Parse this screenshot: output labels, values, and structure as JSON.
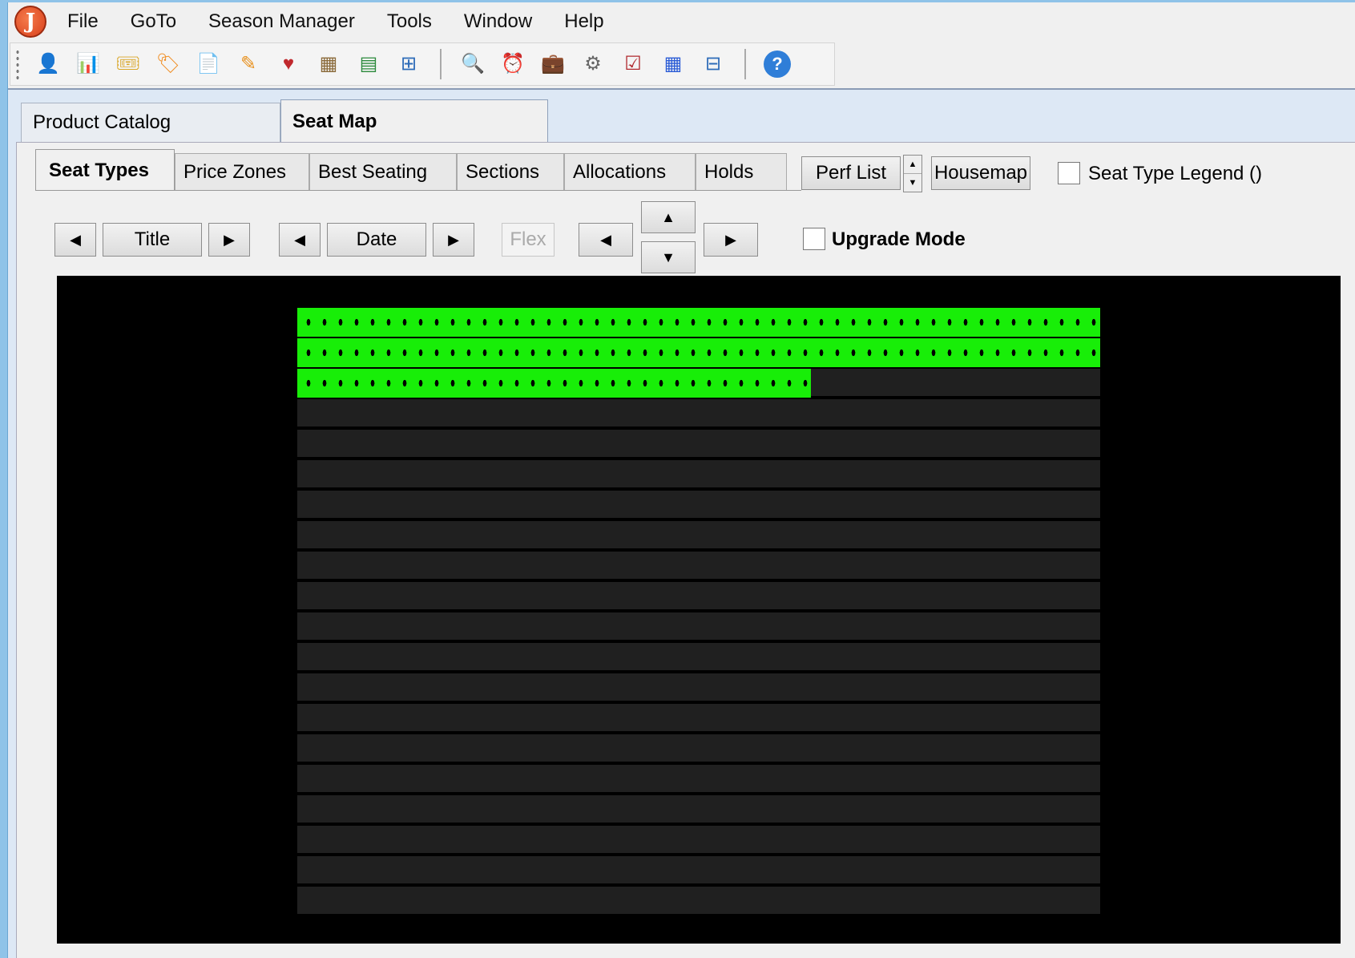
{
  "menu": [
    "File",
    "GoTo",
    "Season Manager",
    "Tools",
    "Window",
    "Help"
  ],
  "toolbar": {
    "icons_group1": [
      "patron-icon",
      "report-icon",
      "ticket-icon",
      "pricing-icon",
      "document-icon",
      "edit-ticket-icon",
      "donation-icon",
      "grid-edit-icon",
      "excel-icon",
      "network-icon"
    ],
    "icons_group2": [
      "search-user-icon",
      "alarm-clock-icon",
      "briefcase-icon",
      "settings-gear-icon",
      "checklist-icon",
      "calendar-grid-icon",
      "network-search-icon"
    ],
    "icons_group3": [
      "help-icon"
    ]
  },
  "outer_tabs": {
    "product_catalog": "Product Catalog",
    "seat_map": "Seat Map"
  },
  "inner_tabs": {
    "seat_types": "Seat Types",
    "price_zones": "Price Zones",
    "best_seating": "Best Seating",
    "sections": "Sections",
    "allocations": "Allocations",
    "holds": "Holds"
  },
  "controls": {
    "perf_list": "Perf List",
    "housemap": "Housemap",
    "seat_type_legend": "Seat Type Legend  ()",
    "title": "Title",
    "date": "Date",
    "flex": "Flex",
    "upgrade_mode": "Upgrade Mode"
  },
  "seat_map": {
    "total_rows": 20,
    "row_fill_fractions": [
      1,
      1,
      0.64,
      0,
      0,
      0,
      0,
      0,
      0,
      0,
      0,
      0,
      0,
      0,
      0,
      0,
      0,
      0,
      0,
      0
    ],
    "fill_color": "#18ee08",
    "empty_row_color": "#202020",
    "background_color": "#000000"
  }
}
